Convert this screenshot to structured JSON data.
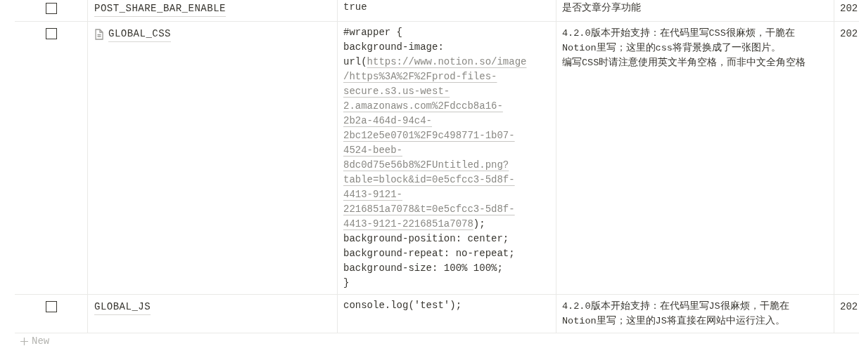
{
  "table": {
    "rows": [
      {
        "checked": false,
        "name": "POST_SHARE_BAR_ENABLE",
        "has_page_icon": false,
        "value": [
          [
            {
              "text": "true",
              "link": false
            }
          ]
        ],
        "description": [
          "是否文章分享功能"
        ],
        "date": "202"
      },
      {
        "checked": false,
        "name": "GLOBAL_CSS",
        "has_page_icon": true,
        "value": [
          [
            {
              "text": "#wrapper {",
              "link": false
            }
          ],
          [
            {
              "text": "background-image:",
              "link": false
            }
          ],
          [
            {
              "text": "url(",
              "link": false
            },
            {
              "text": "https://www.notion.so/image",
              "link": true
            }
          ],
          [
            {
              "text": "/https%3A%2F%2Fprod-files-",
              "link": true
            }
          ],
          [
            {
              "text": "secure.s3.us-west-",
              "link": true
            }
          ],
          [
            {
              "text": "2.amazonaws.com%2Fdccb8a16-",
              "link": true
            }
          ],
          [
            {
              "text": "2b2a-464d-94c4-",
              "link": true
            }
          ],
          [
            {
              "text": "2bc12e5e0701%2F9c498771-1b07-",
              "link": true
            }
          ],
          [
            {
              "text": "4524-beeb-",
              "link": true
            }
          ],
          [
            {
              "text": "8dc0d75e56b8%2FUntitled.png?",
              "link": true
            }
          ],
          [
            {
              "text": "table=block&id=0e5cfcc3-5d8f-",
              "link": true
            }
          ],
          [
            {
              "text": "4413-9121-",
              "link": true
            }
          ],
          [
            {
              "text": "2216851a7078&t=0e5cfcc3-5d8f-",
              "link": true
            }
          ],
          [
            {
              "text": "4413-9121-2216851a7078",
              "link": true
            },
            {
              "text": ");",
              "link": false
            }
          ],
          [
            {
              "text": "background-position: center;",
              "link": false
            }
          ],
          [
            {
              "text": "background-repeat: no-repeat;",
              "link": false
            }
          ],
          [
            {
              "text": "background-size: 100% 100%;",
              "link": false
            }
          ],
          [
            {
              "text": "}",
              "link": false
            }
          ]
        ],
        "description": [
          "4.2.0版本开始支持：在代码里写CSS很麻烦，干脆在Notion里写；这里的css将背景换成了一张图片。",
          "编写CSS时请注意使用英文半角空格，而非中文全角空格"
        ],
        "date": "202"
      },
      {
        "checked": false,
        "name": "GLOBAL_JS",
        "has_page_icon": false,
        "value": [
          [
            {
              "text": "console.log('test');",
              "link": false
            }
          ]
        ],
        "description": [
          "4.2.0版本开始支持：在代码里写JS很麻烦，干脆在Notion里写；这里的JS将直接在网站中运行注入。"
        ],
        "date": "202"
      }
    ]
  },
  "new_row": {
    "label": "New"
  }
}
